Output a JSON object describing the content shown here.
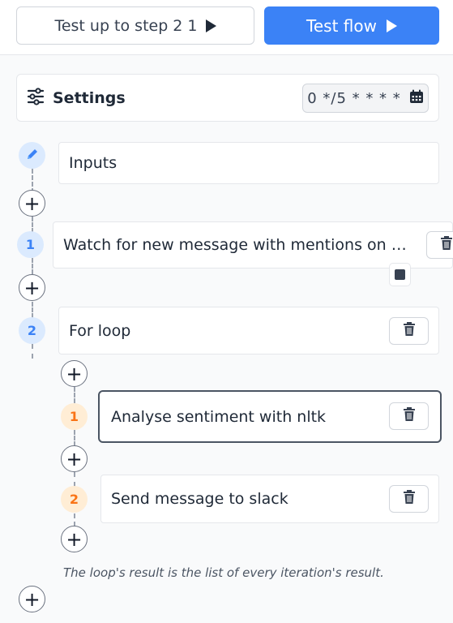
{
  "toolbar": {
    "test_up_to_label": "Test up to step 2 1",
    "test_flow_label": "Test flow"
  },
  "settings": {
    "label": "Settings",
    "schedule": "0 */5 * * * *"
  },
  "flow": {
    "inputs_label": "Inputs",
    "steps": [
      {
        "number": "1",
        "label": "Watch for new message with mentions on Hacker News"
      },
      {
        "number": "2",
        "label": "For loop"
      }
    ],
    "loop_steps": [
      {
        "number": "1",
        "label": "Analyse sentiment with nltk"
      },
      {
        "number": "2",
        "label": "Send message to slack"
      }
    ],
    "loop_note": "The loop's result is the list of every iteration's result."
  },
  "icons": {
    "settings": "sliders-icon",
    "schedule": "calendar-icon",
    "inputs": "pencil-icon",
    "delete": "trash-icon",
    "add": "plus-icon",
    "play": "play-icon",
    "stop": "stop-icon"
  },
  "colors": {
    "primary": "#3b82f6",
    "step_badge_bg": "#dbeafe",
    "loop_badge_bg": "#ffedd5",
    "loop_badge_fg": "#f97316"
  }
}
